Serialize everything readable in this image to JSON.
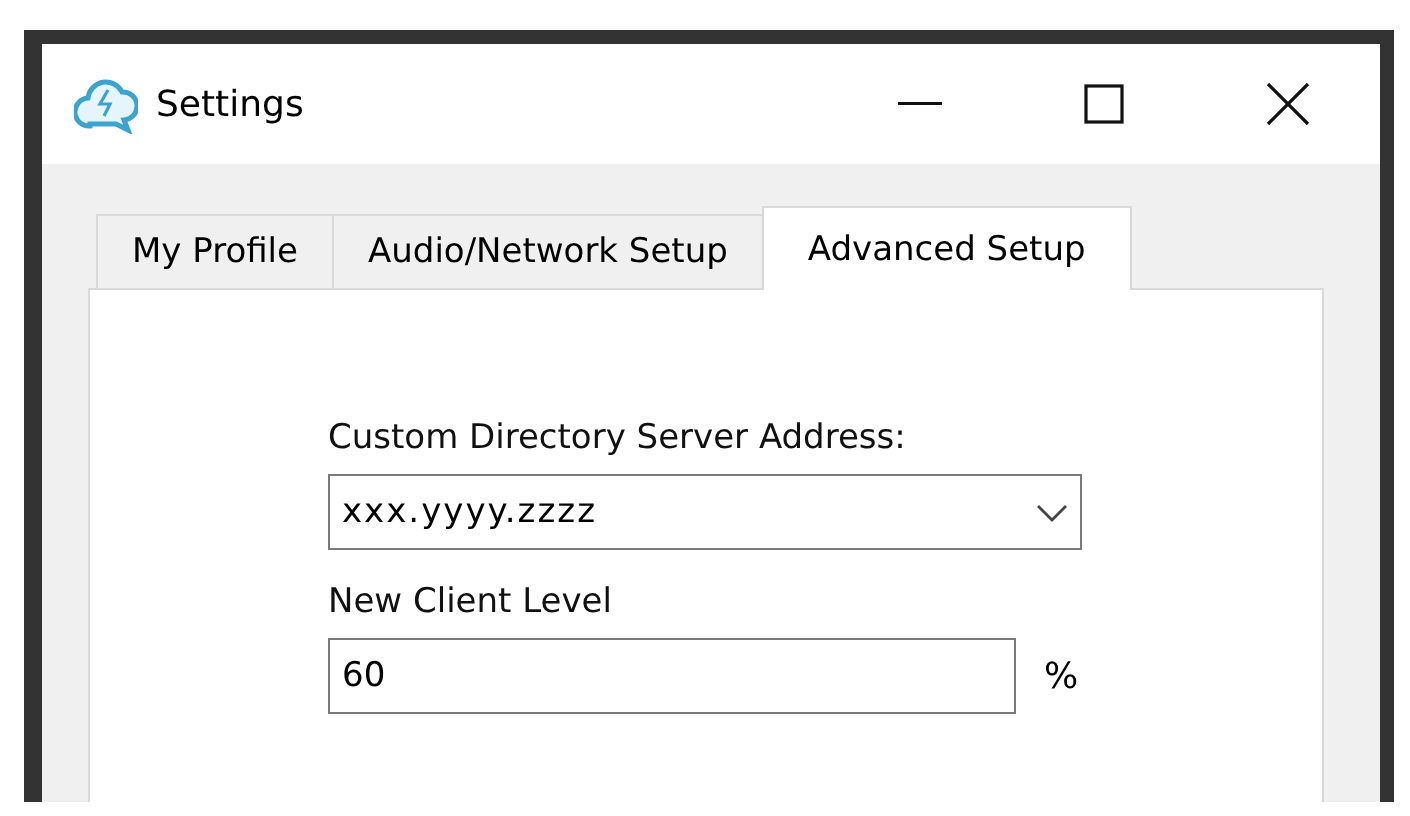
{
  "window": {
    "title": "Settings"
  },
  "tabs": [
    {
      "label": "My Profile",
      "selected": false
    },
    {
      "label": "Audio/Network Setup",
      "selected": false
    },
    {
      "label": "Advanced Setup",
      "selected": true
    }
  ],
  "fields": [
    {
      "kind": "dropdown",
      "label": "Custom Directory Server Address:",
      "value": "xxx.yyyy.zzzz"
    },
    {
      "kind": "text",
      "label": "New Client Level",
      "value": "60",
      "unit": "%"
    }
  ]
}
